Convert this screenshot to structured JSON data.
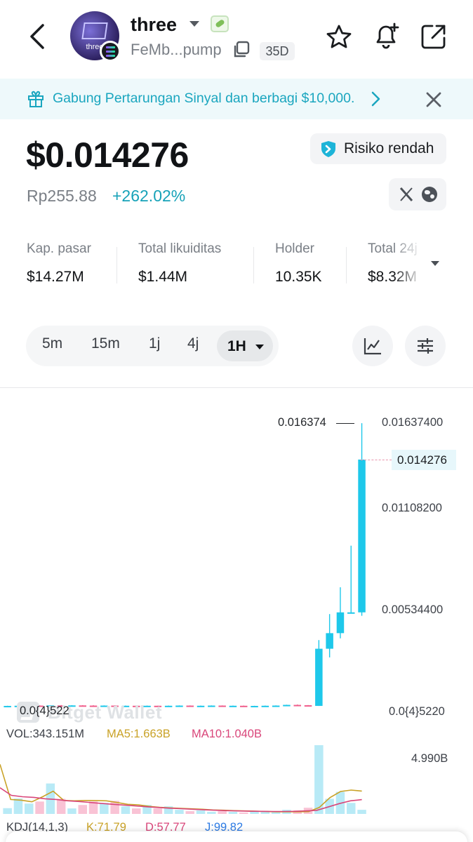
{
  "header": {
    "token_name": "three",
    "address": "FeMb...pump",
    "age": "35D",
    "avatar_text": "three"
  },
  "banner": {
    "text": "Gabung Pertarungan Sinyal dan berbagi $10,000."
  },
  "price": {
    "usd": "$0.014276",
    "local": "Rp255.88",
    "change": "+262.02%",
    "risk_label": "Risiko rendah"
  },
  "stats": [
    {
      "label": "Kap. pasar",
      "value": "$14.27M"
    },
    {
      "label": "Total likuiditas",
      "value": "$1.44M"
    },
    {
      "label": "Holder",
      "value": "10.35K"
    },
    {
      "label": "Total 24j",
      "value": "$8.32M"
    }
  ],
  "intervals": {
    "options": [
      "5m",
      "15m",
      "1j",
      "4j"
    ],
    "selected": "1H"
  },
  "chart": {
    "y_labels": [
      "0.01637400",
      "0.01108200",
      "0.00534400",
      "0.0{4}5220"
    ],
    "current_price_label": "0.014276",
    "high_label": "0.016374",
    "low_label": "0.0{4}522",
    "watermark": "Bitget Wallet",
    "volume": {
      "vol": "VOL:343.151M",
      "ma5": "MA5:1.663B",
      "ma10": "MA10:1.040B",
      "axis_max": "4.990B"
    },
    "kdj": {
      "title": "KDJ(14,1,3)",
      "k": "K:71.79",
      "d": "D:57.77",
      "j": "J:99.82"
    },
    "colors": {
      "up": "#1ec8ea",
      "down": "#f05f8c",
      "ma5": "#c9a227",
      "ma10": "#d9467a"
    }
  },
  "chart_data": {
    "type": "candlestick",
    "y_scale": "linear",
    "candles": [
      {
        "o": 5e-05,
        "h": 6e-05,
        "l": 5e-05,
        "c": 5e-05
      },
      {
        "o": 5e-05,
        "h": 7e-05,
        "l": 4e-05,
        "c": 6e-05
      },
      {
        "o": 6e-05,
        "h": 8e-05,
        "l": 5e-05,
        "c": 7e-05
      },
      {
        "o": 7e-05,
        "h": 9e-05,
        "l": 6e-05,
        "c": 6e-05
      },
      {
        "o": 6e-05,
        "h": 8e-05,
        "l": 5e-05,
        "c": 8e-05
      },
      {
        "o": 8e-05,
        "h": 0.0001,
        "l": 7e-05,
        "c": 7e-05
      },
      {
        "o": 7e-05,
        "h": 9e-05,
        "l": 6e-05,
        "c": 8e-05
      },
      {
        "o": 8e-05,
        "h": 9e-05,
        "l": 6e-05,
        "c": 7e-05
      },
      {
        "o": 7e-05,
        "h": 9e-05,
        "l": 6e-05,
        "c": 6e-05
      },
      {
        "o": 6e-05,
        "h": 8e-05,
        "l": 5e-05,
        "c": 7e-05
      },
      {
        "o": 7e-05,
        "h": 8e-05,
        "l": 6e-05,
        "c": 6e-05
      },
      {
        "o": 6e-05,
        "h": 7e-05,
        "l": 5e-05,
        "c": 6e-05
      },
      {
        "o": 6e-05,
        "h": 7e-05,
        "l": 5e-05,
        "c": 5e-05
      },
      {
        "o": 5e-05,
        "h": 7e-05,
        "l": 5e-05,
        "c": 6e-05
      },
      {
        "o": 6e-05,
        "h": 6e-05,
        "l": 5e-05,
        "c": 5e-05
      },
      {
        "o": 5e-05,
        "h": 7e-05,
        "l": 5e-05,
        "c": 6e-05
      },
      {
        "o": 6e-05,
        "h": 8e-05,
        "l": 5e-05,
        "c": 7e-05
      },
      {
        "o": 7e-05,
        "h": 8e-05,
        "l": 6e-05,
        "c": 6e-05
      },
      {
        "o": 6e-05,
        "h": 7e-05,
        "l": 5e-05,
        "c": 6e-05
      },
      {
        "o": 6e-05,
        "h": 8e-05,
        "l": 5e-05,
        "c": 7e-05
      },
      {
        "o": 7e-05,
        "h": 8e-05,
        "l": 6e-05,
        "c": 6e-05
      },
      {
        "o": 6e-05,
        "h": 7e-05,
        "l": 5e-05,
        "c": 6e-05
      },
      {
        "o": 6e-05,
        "h": 7e-05,
        "l": 5e-05,
        "c": 5e-05
      },
      {
        "o": 5e-05,
        "h": 6e-05,
        "l": 5e-05,
        "c": 5e-05
      },
      {
        "o": 5e-05,
        "h": 7e-05,
        "l": 5e-05,
        "c": 6e-05
      },
      {
        "o": 6e-05,
        "h": 8e-05,
        "l": 5e-05,
        "c": 7e-05
      },
      {
        "o": 7e-05,
        "h": 0.00012,
        "l": 6e-05,
        "c": 0.00011
      },
      {
        "o": 0.00011,
        "h": 0.00013,
        "l": 8e-05,
        "c": 9e-05
      },
      {
        "o": 9e-05,
        "h": 0.0001,
        "l": 6e-05,
        "c": 7e-05
      },
      {
        "o": 5e-05,
        "h": 0.00385,
        "l": 5e-05,
        "c": 0.00335
      },
      {
        "o": 0.00335,
        "h": 0.00535,
        "l": 0.00285,
        "c": 0.00425
      },
      {
        "o": 0.00425,
        "h": 0.0069,
        "l": 0.00395,
        "c": 0.00545
      },
      {
        "o": 0.00545,
        "h": 0.0093,
        "l": 0.0054,
        "c": 0.00545
      },
      {
        "o": 0.00545,
        "h": 0.01637,
        "l": 0.00525,
        "c": 0.01427
      }
    ],
    "volume": [
      0.42,
      1.12,
      0.75,
      0.9,
      2.21,
      1.1,
      0.4,
      0.65,
      0.9,
      0.8,
      0.95,
      0.55,
      0.4,
      0.65,
      0.4,
      0.55,
      0.3,
      0.2,
      0.25,
      0.15,
      0.2,
      0.15,
      0.1,
      0.2,
      0.15,
      0.2,
      0.3,
      0.25,
      0.45,
      4.99,
      1.1,
      1.6,
      0.8,
      0.3
    ],
    "ma5": [
      3.6,
      1.05,
      1.0,
      0.88,
      1.25,
      1.65,
      0.98,
      0.95,
      0.98,
      0.97,
      0.95,
      0.83,
      0.7,
      0.66,
      0.55,
      0.48,
      0.44,
      0.4,
      0.37,
      0.34,
      0.29,
      0.27,
      0.24,
      0.22,
      0.2,
      0.18,
      0.16,
      0.16,
      0.16,
      0.17,
      0.47,
      1.18,
      1.63,
      1.73,
      1.66
    ],
    "ma10": [
      1.9,
      1.35,
      1.25,
      1.2,
      1.1,
      1.05,
      0.95,
      0.9,
      0.83,
      0.76,
      0.7,
      0.64,
      0.58,
      0.52,
      0.47,
      0.42,
      0.38,
      0.34,
      0.3,
      0.27,
      0.24,
      0.22,
      0.2,
      0.19,
      0.18,
      0.18,
      0.19,
      0.22,
      0.26,
      0.5,
      0.75,
      0.95,
      1.04
    ],
    "ylim": [
      5.22e-05,
      0.016374
    ],
    "title": "",
    "xlabel": "",
    "ylabel": ""
  }
}
